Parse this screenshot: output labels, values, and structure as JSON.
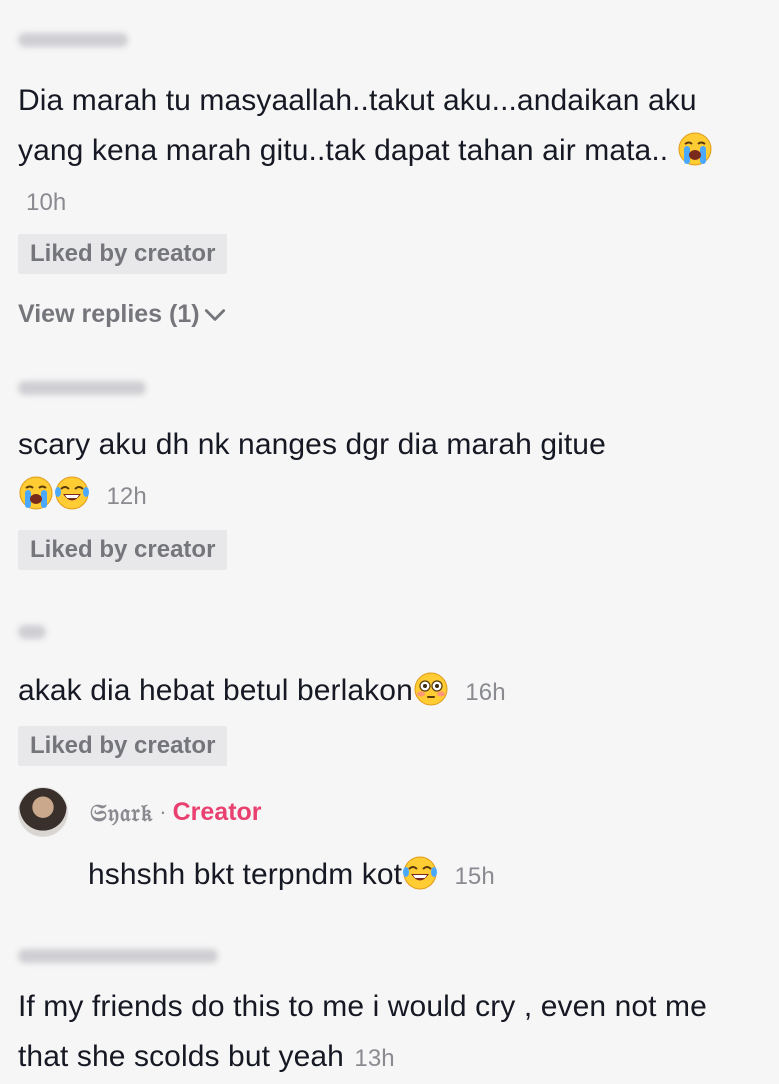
{
  "comments": [
    {
      "text": "Dia marah tu masyaallah..takut aku...andaikan aku yang kena marah gitu..tak dapat tahan air mata..",
      "time": "10h",
      "badge": "Liked by creator",
      "view_replies": "View replies (1)"
    },
    {
      "text": "scary aku dh nk nanges dgr dia marah gitue",
      "time": "12h",
      "badge": "Liked by creator"
    },
    {
      "text": "akak dia hebat betul berlakon",
      "time": "16h",
      "badge": "Liked by creator"
    },
    {
      "text": "If my friends do this to me i would cry , even not me that she scolds but yeah",
      "time": "13h"
    }
  ],
  "reply": {
    "username": "𝔖𝔶𝔞𝔯𝔨",
    "separator": "·",
    "creator_label": "Creator",
    "text": "hshshh bkt terpndm kot",
    "time": "15h"
  },
  "icons": {
    "loudly-crying": "loudly-crying-face-icon",
    "tears-of-joy": "face-with-tears-of-joy-icon",
    "flushed": "flushed-face-icon",
    "chevron": "chevron-down-icon"
  },
  "colors": {
    "background": "#f6f6f6",
    "text": "#161823",
    "muted": "#8a8b91",
    "badge_bg": "#e8e8eb",
    "creator": "#ea4070"
  }
}
